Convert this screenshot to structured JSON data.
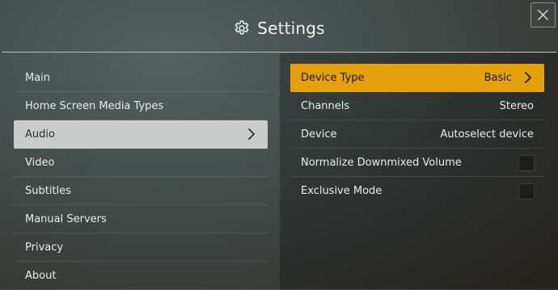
{
  "header": {
    "title": "Settings",
    "title_icon": "gear-icon",
    "close_icon": "close-icon"
  },
  "sidebar": {
    "items": [
      {
        "label": "Main",
        "selected": false
      },
      {
        "label": "Home Screen Media Types",
        "selected": false
      },
      {
        "label": "Audio",
        "selected": true
      },
      {
        "label": "Video",
        "selected": false
      },
      {
        "label": "Subtitles",
        "selected": false
      },
      {
        "label": "Manual Servers",
        "selected": false
      },
      {
        "label": "Privacy",
        "selected": false
      },
      {
        "label": "About",
        "selected": false
      }
    ]
  },
  "audio_settings": {
    "rows": [
      {
        "label": "Device Type",
        "value": "Basic",
        "highlighted": true
      },
      {
        "label": "Channels",
        "value": "Stereo"
      },
      {
        "label": "Device",
        "value": "Autoselect device"
      },
      {
        "label": "Normalize Downmixed Volume",
        "checked": false
      },
      {
        "label": "Exclusive Mode",
        "checked": false
      }
    ]
  },
  "colors": {
    "accent": "#e5a00d",
    "selected_nav_bg": "#c9cccb",
    "checkbox_bg": "#1d1e1c"
  }
}
